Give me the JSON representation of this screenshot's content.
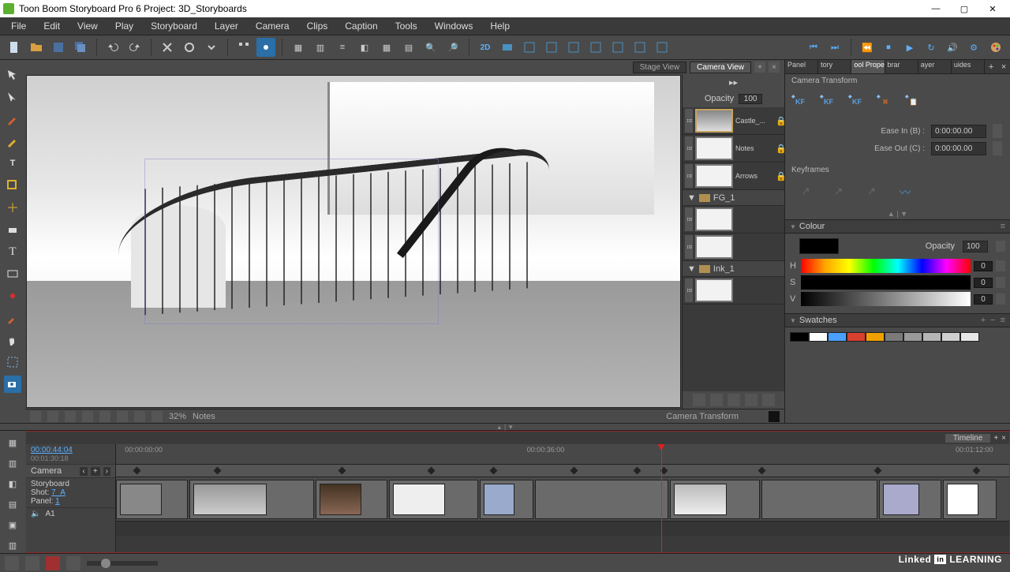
{
  "title": "Toon Boom Storyboard Pro 6 Project: 3D_Storyboards",
  "menu": [
    "File",
    "Edit",
    "View",
    "Play",
    "Storyboard",
    "Layer",
    "Camera",
    "Clips",
    "Caption",
    "Tools",
    "Windows",
    "Help"
  ],
  "viewportTabs": {
    "stage": "Stage View",
    "camera": "Camera View"
  },
  "opacity": {
    "label": "Opacity",
    "value": "100"
  },
  "layers": {
    "items": [
      {
        "label": "Castle_...",
        "sel": true
      },
      {
        "label": "Notes"
      },
      {
        "label": "Arrows"
      }
    ],
    "groupFG": "FG_1",
    "groupInk": "Ink_1"
  },
  "vpZoom": "32%",
  "vpNotes": "Notes",
  "vpMode": "Camera Transform",
  "rightTabs": [
    "Panel",
    "tory",
    "ool Proper",
    "brar",
    "ayer",
    "uides"
  ],
  "camTransform": {
    "title": "Camera Transform",
    "easeInLabel": "Ease In (B) :",
    "easeOutLabel": "Ease Out (C) :",
    "easeIn": "0:00:00.00",
    "easeOut": "0:00:00.00",
    "kfHead": "Keyframes"
  },
  "colour": {
    "title": "Colour",
    "opacityLabel": "Opacity",
    "opacity": "100",
    "h": "0",
    "s": "0",
    "v": "0"
  },
  "swatches": {
    "title": "Swatches",
    "colors": [
      "#000",
      "#fff",
      "#4aa0ff",
      "#d84030",
      "#f0a000",
      "#7a7a7a",
      "#9a9a9a",
      "#b5b5b5",
      "#cfcfcf",
      "#e6e6e6"
    ]
  },
  "timeline": {
    "tab": "Timeline",
    "current": "00:00:44:04",
    "duration": "00:01:30:18",
    "ticks": [
      {
        "t": "00:00:00:00",
        "x": 0
      },
      {
        "t": "00:00:36:00",
        "x": 46
      },
      {
        "t": "00:01:12:00",
        "x": 95
      }
    ],
    "camera": "Camera",
    "storyboard": "Storyboard",
    "shotLabel": "Shot:",
    "shot": "7_A",
    "panelLabel": "Panel:",
    "panel": "1",
    "audioLabel": "A1"
  },
  "branding": "Linked in LEARNING"
}
